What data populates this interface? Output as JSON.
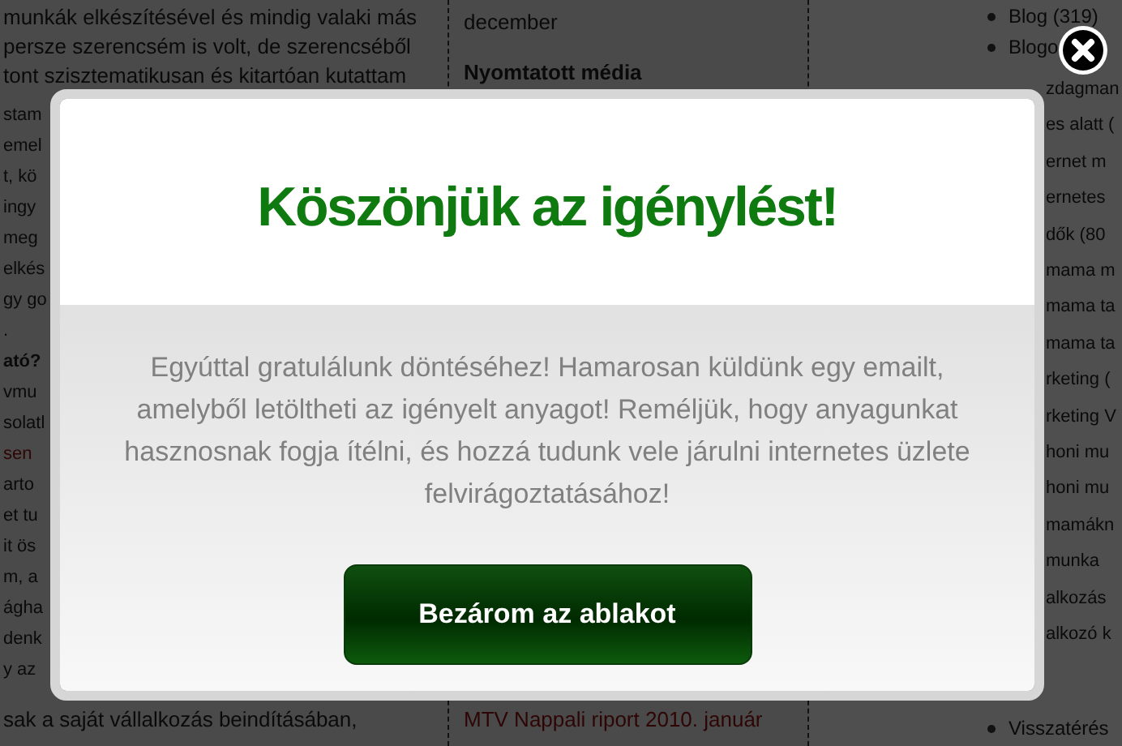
{
  "background_page": {
    "left_column": {
      "lines": [
        "munkák elkészítésével és mindig valaki más",
        "persze szerencsém is volt, de szerencséből",
        "tont szisztematikusan és kitartóan kutattam"
      ],
      "fragments": [
        {
          "text": "stam",
          "kind": "plain"
        },
        {
          "text": "emel",
          "kind": "plain"
        },
        {
          "text": "t, kö",
          "kind": "plain"
        },
        {
          "text": "ingy",
          "kind": "plain"
        },
        {
          "text": "meg",
          "kind": "plain"
        },
        {
          "text": "elkés",
          "kind": "plain"
        },
        {
          "text": "gy go",
          "kind": "plain"
        },
        {
          "text": ".",
          "kind": "plain"
        },
        {
          "text": "ató?",
          "kind": "heading"
        },
        {
          "text": "vmu",
          "kind": "plain"
        },
        {
          "text": "solatl",
          "kind": "plain"
        },
        {
          "text": "sen",
          "kind": "link"
        },
        {
          "text": "arto",
          "kind": "plain"
        },
        {
          "text": "et tu",
          "kind": "plain"
        },
        {
          "text": "it ös",
          "kind": "plain"
        },
        {
          "text": "m, a",
          "kind": "plain"
        },
        {
          "text": "ágha",
          "kind": "plain"
        },
        {
          "text": "denk",
          "kind": "plain"
        },
        {
          "text": "y az",
          "kind": "plain"
        }
      ],
      "bottom_line": "sak a saját vállalkozás beindításában,"
    },
    "middle_column": {
      "date": "december",
      "heading": "Nyomtatott média",
      "bottom_link": "MTV Nappali riport 2010. január"
    },
    "sidebar": {
      "top_items": [
        "Blog (319)",
        "Blogo"
      ],
      "fragments": [
        "zdagman",
        "es alatt (",
        "ernet m",
        "ernetes",
        "dők (80",
        "mama m",
        "mama ta",
        "mama ta",
        "rketing (",
        "rketing V",
        "honi mu",
        "honi mu",
        "mamákn",
        "munka",
        "alkozás",
        "alkozó k"
      ],
      "bottom_item": "Visszatérés"
    }
  },
  "modal": {
    "title": "Köszönjük az igénylést!",
    "message": "Egyúttal gratulálunk döntéséhez! Hamarosan küldünk egy emailt, amelyből letöltheti az igényelt anyagot! Reméljük, hogy anyagunkat hasznosnak fogja ítélni, és hozzá tudunk vele járulni internetes üzlete felvirágoztatásához!",
    "button": "Bezárom az ablakot"
  }
}
